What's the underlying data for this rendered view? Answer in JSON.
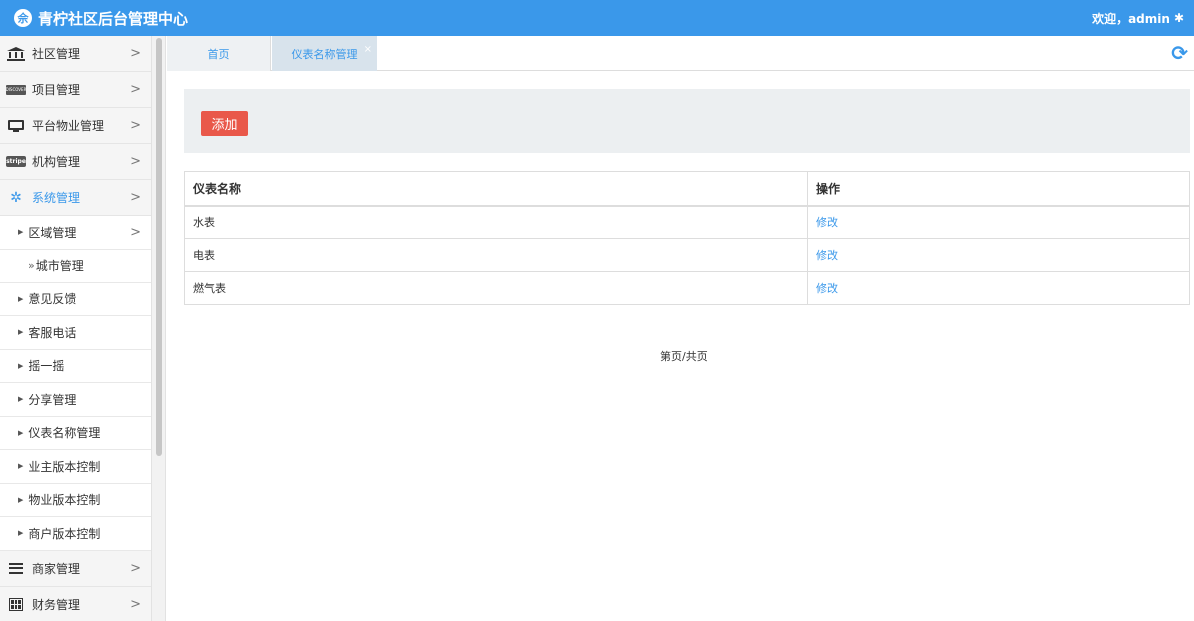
{
  "header": {
    "logo_glyph": "佘",
    "title": "青柠社区后台管理中心",
    "welcome": "欢迎，admin",
    "gear_icon": "gear-icon"
  },
  "sidebar": {
    "items": [
      {
        "label": "社区管理",
        "icon": "bank-icon"
      },
      {
        "label": "项目管理",
        "icon": "discover-card-icon"
      },
      {
        "label": "平台物业管理",
        "icon": "monitor-icon"
      },
      {
        "label": "机构管理",
        "icon": "stripe-icon",
        "icon_text": "stripe"
      },
      {
        "label": "系统管理",
        "icon": "yelp-icon"
      }
    ],
    "card_icon_text": "DISCOVER",
    "sub_items": [
      "区域管理",
      "意见反馈",
      "客服电话",
      "摇一摇",
      "分享管理",
      "仪表名称管理",
      "业主版本控制",
      "物业版本控制",
      "商户版本控制"
    ],
    "subsub_items": [
      "城市管理"
    ],
    "bottom_items": [
      {
        "label": "商家管理",
        "icon": "bars-icon"
      },
      {
        "label": "财务管理",
        "icon": "calculator-icon"
      }
    ],
    "chevron": ">",
    "sub_marker": "»"
  },
  "tabs": [
    {
      "label": "首页"
    },
    {
      "label": "仪表名称管理",
      "close": "×"
    }
  ],
  "toolbar": {
    "add_label": "添加"
  },
  "table": {
    "headers": [
      "仪表名称",
      "操作"
    ],
    "rows": [
      {
        "name": "水表",
        "action": "修改"
      },
      {
        "name": "电表",
        "action": "修改"
      },
      {
        "name": "燃气表",
        "action": "修改"
      }
    ]
  },
  "pager": {
    "text": "第页/共页"
  },
  "accent_color": "#3a98ea",
  "button_color": "#e9584a"
}
